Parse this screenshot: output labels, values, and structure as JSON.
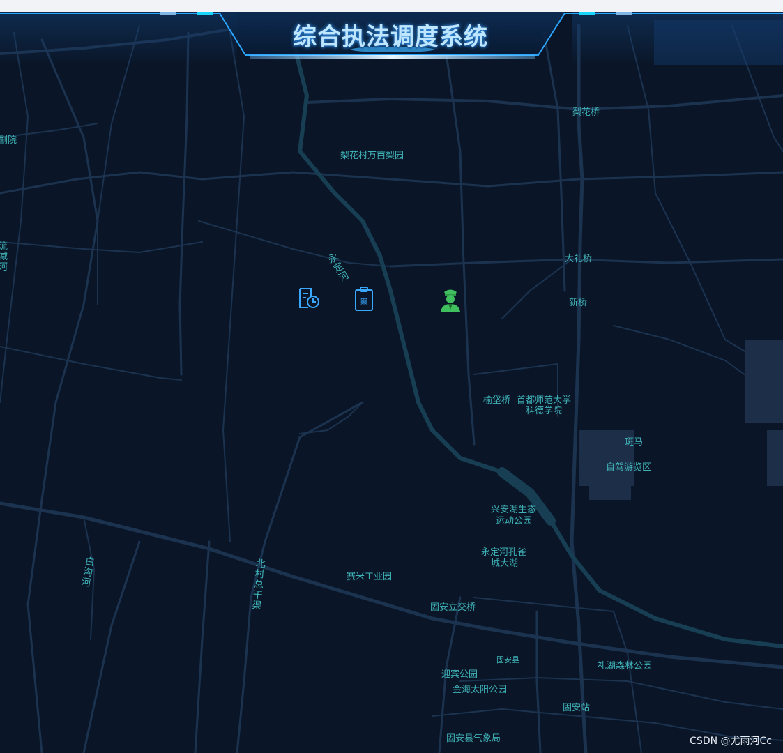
{
  "header": {
    "title": "综合执法调度系统"
  },
  "map": {
    "labels": [
      {
        "id": "lihuaqiao",
        "text": "梨花桥"
      },
      {
        "id": "lihuacun",
        "text": "梨花村万亩梨园"
      },
      {
        "id": "dalqiao",
        "text": "大礼桥"
      },
      {
        "id": "xinqiao",
        "text": "新桥"
      },
      {
        "id": "yudianqiao",
        "text": "榆垡桥"
      },
      {
        "id": "shoudu",
        "text": "首都师范大学"
      },
      {
        "id": "kede",
        "text": "科德学院"
      },
      {
        "id": "banma",
        "text": "斑马"
      },
      {
        "id": "zijia",
        "text": "自驾游览区"
      },
      {
        "id": "xingan1",
        "text": "兴安湖生态"
      },
      {
        "id": "xingan2",
        "text": "运动公园"
      },
      {
        "id": "kongque1",
        "text": "永定河孔雀"
      },
      {
        "id": "kongque2",
        "text": "城大湖"
      },
      {
        "id": "saimi",
        "text": "赛米工业园"
      },
      {
        "id": "guanli",
        "text": "固安立交桥"
      },
      {
        "id": "guanxian",
        "text": "固安县"
      },
      {
        "id": "lihu",
        "text": "礼湖森林公园"
      },
      {
        "id": "yingbin",
        "text": "迎宾公园"
      },
      {
        "id": "jinhai",
        "text": "金海太阳公园"
      },
      {
        "id": "guanzhan",
        "text": "固安站"
      },
      {
        "id": "qixiang",
        "text": "固安县气象局"
      },
      {
        "id": "left-edge-1",
        "text": "剧院"
      },
      {
        "id": "left-edge-2",
        "text": "流"
      },
      {
        "id": "left-edge-3",
        "text": "减"
      },
      {
        "id": "left-edge-4",
        "text": "河"
      }
    ],
    "vertical_labels": [
      {
        "id": "yongdinghe",
        "text": "永定河"
      },
      {
        "id": "baigouhe",
        "text": "白沟河"
      },
      {
        "id": "beicun",
        "text": "北村总干渠"
      }
    ],
    "markers": [
      {
        "id": "schedule-doc",
        "icon": "document-clock-icon",
        "color": "#3aa8ff"
      },
      {
        "id": "case-clipboard",
        "icon": "case-clipboard-icon",
        "color": "#3aa8ff",
        "glyph": "案"
      },
      {
        "id": "officer",
        "icon": "officer-icon",
        "color": "#3fbf5e"
      }
    ]
  },
  "watermark": "CSDN @尤雨河Cc",
  "colors": {
    "background": "#0a1628",
    "road": "#1d3452",
    "label": "#3fb2b6",
    "title": "#bfe6ff",
    "accent": "#2aa6ff"
  }
}
